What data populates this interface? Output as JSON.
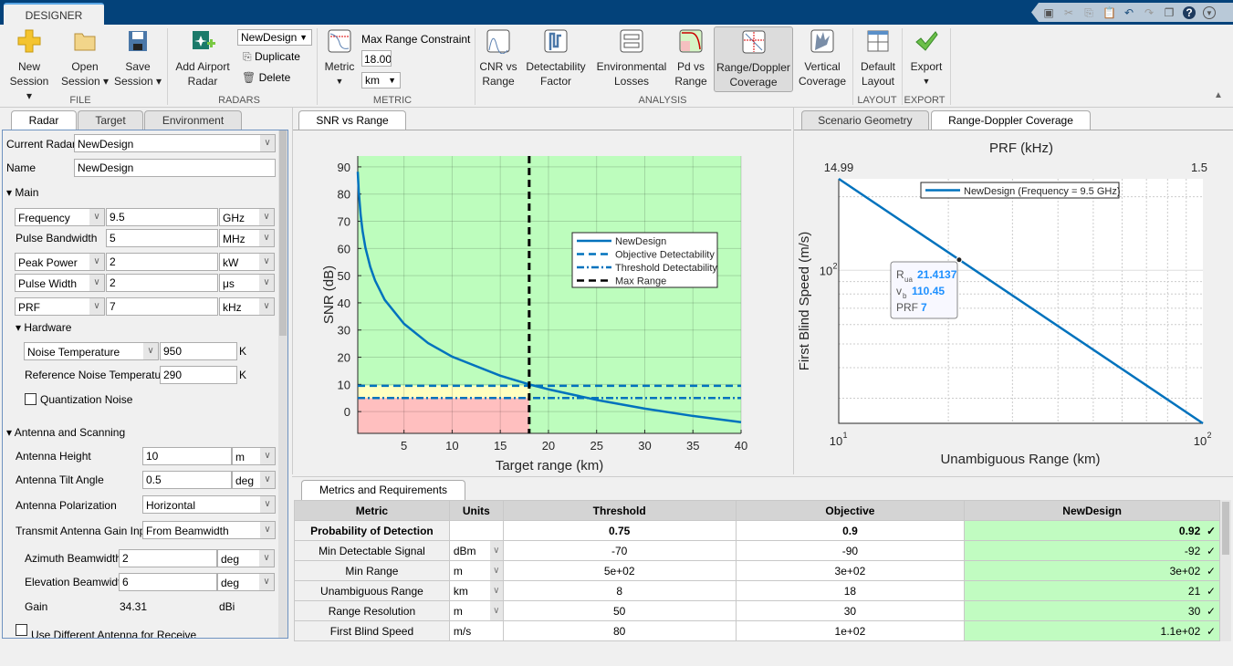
{
  "title_bar": {
    "tab": "DESIGNER",
    "quick_access": [
      "save-icon",
      "cut-icon",
      "copy-icon",
      "paste-icon",
      "undo-icon",
      "redo-icon",
      "window-icon",
      "help-icon",
      "menu-icon"
    ]
  },
  "toolstrip": {
    "file": {
      "group": "FILE",
      "new_session": [
        "New",
        "Session ▾"
      ],
      "open_session": [
        "Open",
        "Session ▾"
      ],
      "save_session": [
        "Save",
        "Session ▾"
      ]
    },
    "radars": {
      "group": "RADARS",
      "add_airport": [
        "Add Airport",
        "Radar"
      ],
      "current": "NewDesign",
      "duplicate": "Duplicate",
      "delete": "Delete"
    },
    "metric": {
      "group": "METRIC",
      "metric": "Metric",
      "constraint_label": "Max Range Constraint",
      "constraint_value": "18.00",
      "unit": "km"
    },
    "analysis": {
      "group": "ANALYSIS",
      "items": [
        [
          "CNR vs",
          "Range"
        ],
        [
          "Detectability",
          "Factor"
        ],
        [
          "Environmental",
          "Losses"
        ],
        [
          "Pd vs",
          "Range"
        ],
        [
          "Range/Doppler",
          "Coverage"
        ],
        [
          "Vertical",
          "Coverage"
        ]
      ],
      "selected": "Range/Doppler Coverage"
    },
    "layout": {
      "group": "LAYOUT",
      "default": [
        "Default",
        "Layout"
      ]
    },
    "export": {
      "group": "EXPORT",
      "label": "Export"
    }
  },
  "left_panel": {
    "tabs": [
      "Radar",
      "Target",
      "Environment"
    ],
    "current_radar_label": "Current Radar",
    "current_radar": "NewDesign",
    "name_label": "Name",
    "name": "NewDesign",
    "main_section": "Main",
    "main_rows": [
      {
        "label": "Frequency",
        "value": "9.5",
        "unit": "GHz",
        "select": true
      },
      {
        "label": "Pulse Bandwidth",
        "value": "5",
        "unit": "MHz",
        "select": false
      },
      {
        "label": "Peak Power",
        "value": "2",
        "unit": "kW",
        "select": true
      },
      {
        "label": "Pulse Width",
        "value": "2",
        "unit": "μs",
        "select": true
      },
      {
        "label": "PRF",
        "value": "7",
        "unit": "kHz",
        "select": true
      }
    ],
    "hardware_section": "Hardware",
    "noise_temp_label": "Noise Temperature",
    "noise_temp": "950",
    "noise_unit": "K",
    "ref_noise_label": "Reference Noise Temperature",
    "ref_noise": "290",
    "ref_noise_unit": "K",
    "quantization_label": "Quantization Noise",
    "quantization_checked": false,
    "antenna_section": "Antenna and Scanning",
    "antenna_height_label": "Antenna Height",
    "antenna_height": "10",
    "antenna_height_unit": "m",
    "tilt_label": "Antenna Tilt Angle",
    "tilt": "0.5",
    "tilt_unit": "deg",
    "polarization_label": "Antenna Polarization",
    "polarization": "Horizontal",
    "gain_input_label": "Transmit Antenna Gain Input",
    "gain_input": "From Beamwidth",
    "az_bw_label": "Azimuth Beamwidth",
    "az_bw": "2",
    "az_bw_unit": "deg",
    "el_bw_label": "Elevation Beamwidth",
    "el_bw": "6",
    "el_bw_unit": "deg",
    "gain_label": "Gain",
    "gain": "34.31",
    "gain_unit": "dBi",
    "diff_antenna_label": "Use Different Antenna for Receive",
    "diff_antenna_checked": false
  },
  "snr_panel": {
    "tab": "SNR vs Range"
  },
  "right_panel": {
    "tabs": [
      "Scenario Geometry",
      "Range-Doppler Coverage"
    ],
    "active_tab": "Range-Doppler Coverage"
  },
  "chart_data": [
    {
      "type": "line",
      "xlabel": "Target range (km)",
      "ylabel": "SNR (dB)",
      "xlim": [
        0.2,
        40
      ],
      "ylim": [
        -8,
        94
      ],
      "xticks": [
        5,
        10,
        15,
        20,
        25,
        30,
        35,
        40
      ],
      "yticks": [
        0,
        10,
        20,
        30,
        40,
        50,
        60,
        70,
        80,
        90
      ],
      "grid": true,
      "legend": "right",
      "series": [
        {
          "name": "NewDesign",
          "style": "solid",
          "color": "#0072bd",
          "x": [
            0.2,
            0.3,
            0.5,
            0.7,
            1,
            1.5,
            2,
            3,
            5,
            7.5,
            10,
            15,
            18,
            20,
            25,
            30,
            35,
            40
          ],
          "y": [
            88.2,
            81.1,
            72.3,
            66.4,
            60.2,
            53.2,
            48.2,
            41.1,
            32.3,
            25.2,
            20.2,
            13.2,
            10,
            8.2,
            4.3,
            1.1,
            -1.6,
            -3.9
          ]
        },
        {
          "name": "Objective Detectability",
          "style": "dashed",
          "color": "#0072bd",
          "y_const": 9.5
        },
        {
          "name": "Threshold Detectability",
          "style": "dashdot",
          "color": "#0072bd",
          "y_const": 5
        },
        {
          "name": "Max Range",
          "style": "dashed",
          "color": "#000000",
          "x_const": 18
        }
      ],
      "regions": {
        "pass": "#bdfdbd",
        "marginal": "#ffffc0",
        "fail": "#ffbfbf"
      }
    },
    {
      "type": "line",
      "scale": "log-log",
      "title": "PRF (kHz)",
      "xlabel": "Unambiguous Range (km)",
      "ylabel": "First Blind Speed (m/s)",
      "xlim": [
        10,
        100
      ],
      "ylim": [
        23.7,
        236.6
      ],
      "top_ticks": [
        "14.99",
        "1.5"
      ],
      "xtick_labels": [
        "10",
        "1",
        "10",
        "2"
      ],
      "ytick_label": [
        "10",
        "2"
      ],
      "grid": true,
      "legend": "top",
      "series": [
        {
          "name": "NewDesign (Frequency = 9.5 GHz)",
          "color": "#0072bd",
          "x": [
            10,
            100
          ],
          "y": [
            236.6,
            23.7
          ]
        }
      ],
      "datatip": {
        "x": 21.4137,
        "y": 110.45,
        "rua_label": "R",
        "rua_sub": "ua",
        "rua": "21.4137",
        "vb_label": "v",
        "vb_sub": "b",
        "vb": "110.45",
        "prf_label": "PRF",
        "prf": "7"
      }
    }
  ],
  "metrics": {
    "tab": "Metrics and Requirements",
    "headers": [
      "Metric",
      "Units",
      "Threshold",
      "Objective",
      "NewDesign"
    ],
    "rows": [
      {
        "metric": "Probability of Detection",
        "units": "",
        "threshold": "0.75",
        "objective": "0.9",
        "value": "0.92",
        "status": "✓",
        "bold": true,
        "unit_select": false
      },
      {
        "metric": "Min Detectable Signal",
        "units": "dBm",
        "threshold": "-70",
        "objective": "-90",
        "value": "-92",
        "status": "✓",
        "unit_select": true
      },
      {
        "metric": "Min Range",
        "units": "m",
        "threshold": "5e+02",
        "objective": "3e+02",
        "value": "3e+02",
        "status": "✓",
        "unit_select": true
      },
      {
        "metric": "Unambiguous Range",
        "units": "km",
        "threshold": "8",
        "objective": "18",
        "value": "21",
        "status": "✓",
        "unit_select": true
      },
      {
        "metric": "Range Resolution",
        "units": "m",
        "threshold": "50",
        "objective": "30",
        "value": "30",
        "status": "✓",
        "unit_select": true
      },
      {
        "metric": "First Blind Speed",
        "units": "m/s",
        "threshold": "80",
        "objective": "1e+02",
        "value": "1.1e+02",
        "status": "✓",
        "unit_select": false
      }
    ]
  }
}
